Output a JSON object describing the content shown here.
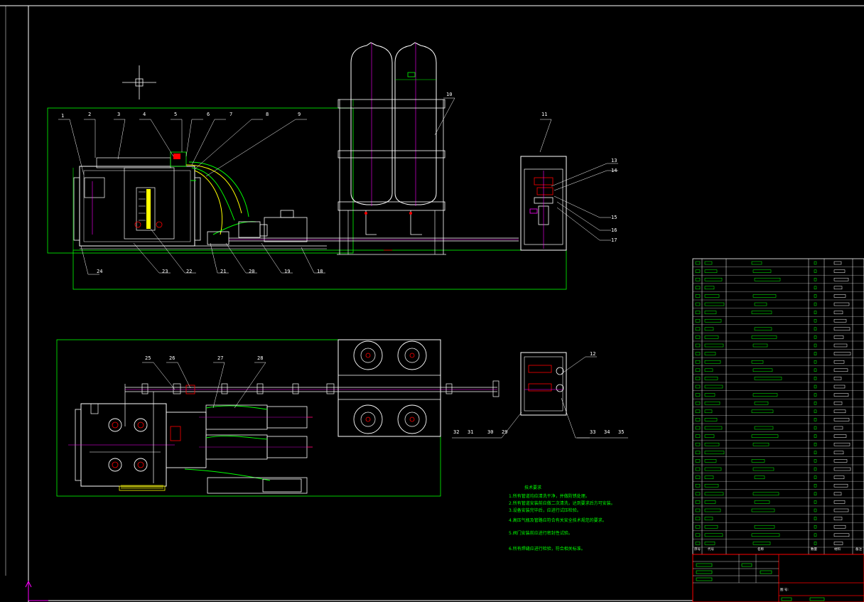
{
  "drawing": {
    "part_labels": {
      "top": [
        "1",
        "2",
        "3",
        "4",
        "5",
        "6",
        "7",
        "8",
        "9",
        "10",
        "11",
        "13",
        "14",
        "15",
        "16",
        "17",
        "18",
        "19",
        "20",
        "21",
        "22",
        "23",
        "24"
      ],
      "plan": [
        "25",
        "26",
        "27",
        "28",
        "12",
        "32",
        "31",
        "30",
        "29",
        "33",
        "34",
        "35"
      ]
    },
    "notes": {
      "title": "技术要求",
      "lines": [
        "1.所有管道均应清洗干净，并做防锈处理。",
        "2.所有管道安装前应做二次清洗，达到要求后方可安装。",
        "3.设备安装完毕后，应进行试压检验。",
        "4.高压气瓶及管路应符合有关安全技术规范的要求。",
        "5.阀门安装前应进行密封性试验。",
        "6.所有焊缝应进行检验，符合相关标准。"
      ]
    },
    "table_headers": {
      "seq": "序号",
      "code": "代号",
      "name": "名称",
      "qty": "数量",
      "material": "材料",
      "remark": "备注"
    },
    "title_block": {
      "drawing_no_label": "图 号:"
    },
    "colors": {
      "background": "#000000",
      "frame": "#ffffff",
      "outline": "#00ff00",
      "equipment": "#ffffff",
      "center": "#ff00ff",
      "accent": "#ff0000",
      "highlight": "#ffff00"
    }
  }
}
